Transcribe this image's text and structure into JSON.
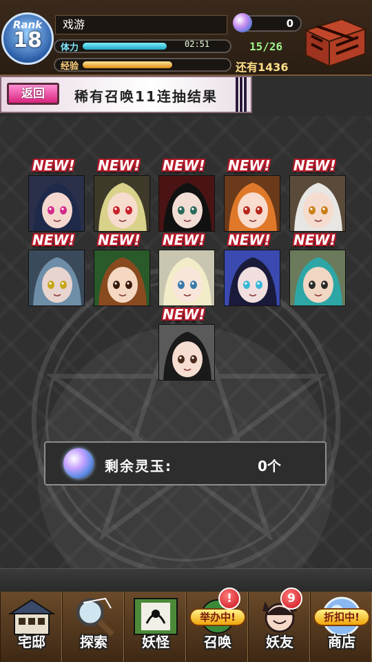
{
  "player": {
    "rank_label": "Rank",
    "rank": "18",
    "name": "戏游",
    "stamina_label": "体力",
    "stamina_timer": "02:51",
    "stamina": "15/26",
    "stamina_fraction": 0.58,
    "exp_label": "经验",
    "exp_remaining": "还有1436",
    "exp_fraction": 0.62,
    "gems": "0"
  },
  "title_bar": {
    "back_label": "返回",
    "title": "稀有召唤11连抽结果"
  },
  "results": {
    "new_label": "NEW!",
    "characters": [
      {
        "hair": "#1f2a4a",
        "skin": "#f4d8d0",
        "eye": "#d22a8a",
        "bg": "#2a2f4a"
      },
      {
        "hair": "#d9d28a",
        "skin": "#f6dccd",
        "eye": "#c8212a",
        "bg": "#3d3a2a"
      },
      {
        "hair": "#111111",
        "skin": "#f2ddd4",
        "eye": "#2a6a5a",
        "bg": "#4a1414"
      },
      {
        "hair": "#e0782a",
        "skin": "#f8dccd",
        "eye": "#b8261a",
        "bg": "#6a3a1a"
      },
      {
        "hair": "#e8e6e2",
        "skin": "#f5dccf",
        "eye": "#c9801a",
        "bg": "#5a4a3a"
      },
      {
        "hair": "#6e8ea8",
        "skin": "#e8d4cf",
        "eye": "#c7a61a",
        "bg": "#3a4a5a"
      },
      {
        "hair": "#8a4a1f",
        "skin": "#f5d8c2",
        "eye": "#3a1a0a",
        "bg": "#2a5a2a"
      },
      {
        "hair": "#f2ecc8",
        "skin": "#f8e6da",
        "eye": "#3a7aaa",
        "bg": "#c8c6b0"
      },
      {
        "hair": "#1a1a3a",
        "skin": "#f1dfe0",
        "eye": "#3ab6d8",
        "bg": "#3a4ab0"
      },
      {
        "hair": "#2ea6a6",
        "skin": "#f2d6c4",
        "eye": "#2a2a2a",
        "bg": "#6a7a5a"
      },
      {
        "hair": "#1a1a1a",
        "skin": "#f6ddd2",
        "eye": "#4a2a1a",
        "bg": "#5a5a5a"
      }
    ]
  },
  "remaining": {
    "label": "剩余灵玉:",
    "value": "0个"
  },
  "nav": {
    "items": [
      {
        "label": "宅邸",
        "icon": "mansion-icon"
      },
      {
        "label": "探索",
        "icon": "magnifier-icon"
      },
      {
        "label": "妖怪",
        "icon": "scroll-icon"
      },
      {
        "label": "召唤",
        "icon": "summon-icon",
        "badge": "!",
        "tag": "举办中!"
      },
      {
        "label": "妖友",
        "icon": "friend-icon",
        "badge": "9"
      },
      {
        "label": "商店",
        "icon": "shop-orb-icon",
        "tag": "折扣中!"
      }
    ]
  },
  "colors": {
    "accent_pink": "#d9257e",
    "stamina": "#1fa6c4",
    "exp": "#e08b12",
    "new_outline": "#b81a2a"
  }
}
